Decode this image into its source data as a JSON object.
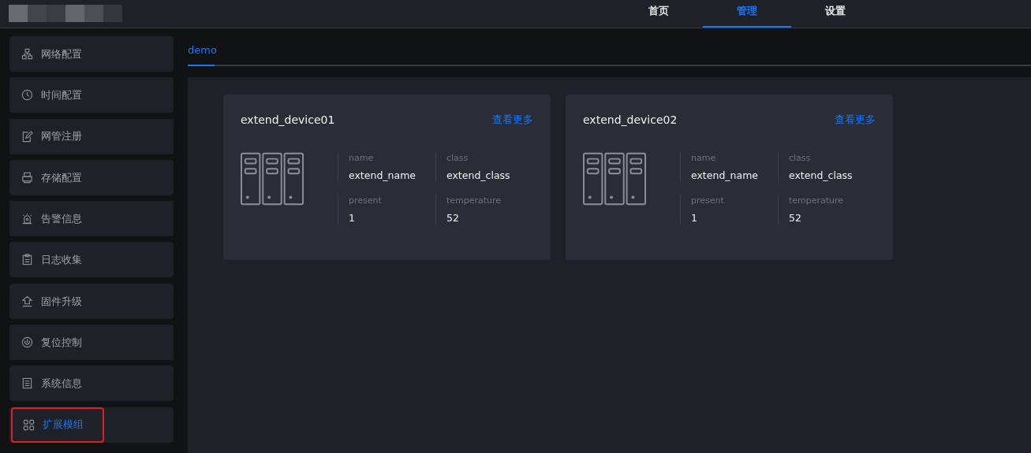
{
  "top_nav": [
    {
      "label": "首页",
      "selected": false
    },
    {
      "label": "管理",
      "selected": true
    },
    {
      "label": "设置",
      "selected": false
    }
  ],
  "sidebar": {
    "items": [
      {
        "label": "网络配置",
        "selected": false,
        "outlined": false
      },
      {
        "label": "时间配置",
        "selected": false,
        "outlined": false
      },
      {
        "label": "网管注册",
        "selected": false,
        "outlined": false
      },
      {
        "label": "存储配置",
        "selected": false,
        "outlined": false
      },
      {
        "label": "告警信息",
        "selected": false,
        "outlined": false
      },
      {
        "label": "日志收集",
        "selected": false,
        "outlined": false
      },
      {
        "label": "固件升级",
        "selected": false,
        "outlined": false
      },
      {
        "label": "复位控制",
        "selected": false,
        "outlined": false
      },
      {
        "label": "系统信息",
        "selected": false,
        "outlined": false
      },
      {
        "label": "扩展模组",
        "selected": true,
        "outlined": true
      }
    ]
  },
  "tabs": [
    {
      "label": "demo",
      "selected": true
    }
  ],
  "devices": [
    {
      "title": "extend_device01",
      "more": "查看更多",
      "fields": [
        {
          "label": "name",
          "value": "extend_name"
        },
        {
          "label": "class",
          "value": "extend_class"
        },
        {
          "label": "present",
          "value": "1"
        },
        {
          "label": "temperature",
          "value": "52"
        }
      ]
    },
    {
      "title": "extend_device02",
      "more": "查看更多",
      "fields": [
        {
          "label": "name",
          "value": "extend_name"
        },
        {
          "label": "class",
          "value": "extend_class"
        },
        {
          "label": "present",
          "value": "1"
        },
        {
          "label": "temperature",
          "value": "52"
        }
      ]
    }
  ]
}
